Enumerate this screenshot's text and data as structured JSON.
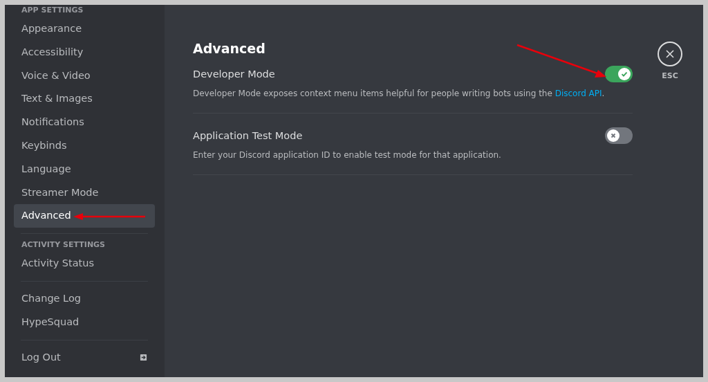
{
  "sidebar": {
    "sections": [
      {
        "header": "APP SETTINGS",
        "items": [
          {
            "label": "Appearance",
            "selected": false
          },
          {
            "label": "Accessibility",
            "selected": false
          },
          {
            "label": "Voice & Video",
            "selected": false
          },
          {
            "label": "Text & Images",
            "selected": false
          },
          {
            "label": "Notifications",
            "selected": false
          },
          {
            "label": "Keybinds",
            "selected": false
          },
          {
            "label": "Language",
            "selected": false
          },
          {
            "label": "Streamer Mode",
            "selected": false
          },
          {
            "label": "Advanced",
            "selected": true
          }
        ]
      },
      {
        "header": "ACTIVITY SETTINGS",
        "items": [
          {
            "label": "Activity Status",
            "selected": false
          }
        ]
      },
      {
        "items": [
          {
            "label": "Change Log",
            "selected": false
          },
          {
            "label": "HypeSquad",
            "selected": false
          }
        ]
      },
      {
        "items": [
          {
            "label": "Log Out",
            "selected": false,
            "kind": "logout"
          }
        ]
      }
    ]
  },
  "page": {
    "title": "Advanced",
    "settings": [
      {
        "label": "Developer Mode",
        "on": true,
        "description": "Developer Mode exposes context menu items helpful for people writing bots using the ",
        "link": "Discord API",
        "description_end": "."
      },
      {
        "label": "Application Test Mode",
        "on": false,
        "description": "Enter your Discord application ID to enable test mode for that application."
      }
    ]
  },
  "close": {
    "label": "ESC"
  }
}
